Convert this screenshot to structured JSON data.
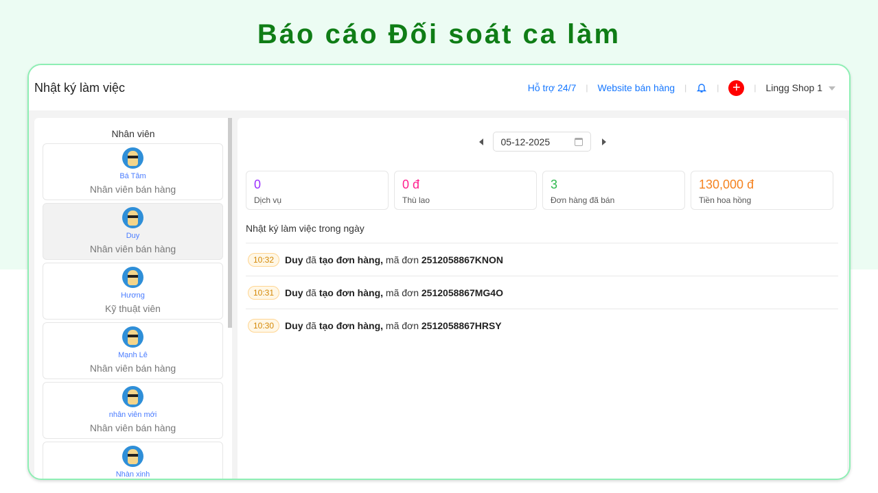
{
  "page_title": "Báo cáo Đối soát ca làm",
  "header": {
    "title": "Nhật ký làm việc",
    "support": "Hỗ trợ 24/7",
    "website": "Website bán hàng",
    "shop": "Lingg Shop 1",
    "plus": "+"
  },
  "sidebar": {
    "heading": "Nhân viên",
    "employees": [
      {
        "name": "Bá Tâm",
        "role": "Nhân viên bán hàng"
      },
      {
        "name": "Duy",
        "role": "Nhân viên bán hàng"
      },
      {
        "name": "Hương",
        "role": "Kỹ thuật viên"
      },
      {
        "name": "Mạnh Lê",
        "role": "Nhân viên bán hàng"
      },
      {
        "name": "nhân viên mới",
        "role": "Nhân viên bán hàng"
      },
      {
        "name": "Nhàn xinh",
        "role": ""
      }
    ]
  },
  "main": {
    "date": "05-12-2025",
    "stats": [
      {
        "value": "0",
        "label": "Dịch vụ",
        "color": "#9b30ff"
      },
      {
        "value": "0 đ",
        "label": "Thù lao",
        "color": "#ff1f8e"
      },
      {
        "value": "3",
        "label": "Đơn hàng đã bán",
        "color": "#2db84d"
      },
      {
        "value": "130,000 đ",
        "label": "Tiền hoa hồng",
        "color": "#f5821f"
      }
    ],
    "log_title": "Nhật ký làm việc trong ngày",
    "logs": [
      {
        "time": "10:32",
        "user": "Duy",
        "verb": "đã",
        "action": "tạo đơn hàng,",
        "code_label": "mã đơn",
        "code": "2512058867KNON"
      },
      {
        "time": "10:31",
        "user": "Duy",
        "verb": "đã",
        "action": "tạo đơn hàng,",
        "code_label": "mã đơn",
        "code": "2512058867MG4O"
      },
      {
        "time": "10:30",
        "user": "Duy",
        "verb": "đã",
        "action": "tạo đơn hàng,",
        "code_label": "mã đơn",
        "code": "2512058867HRSY"
      }
    ]
  }
}
